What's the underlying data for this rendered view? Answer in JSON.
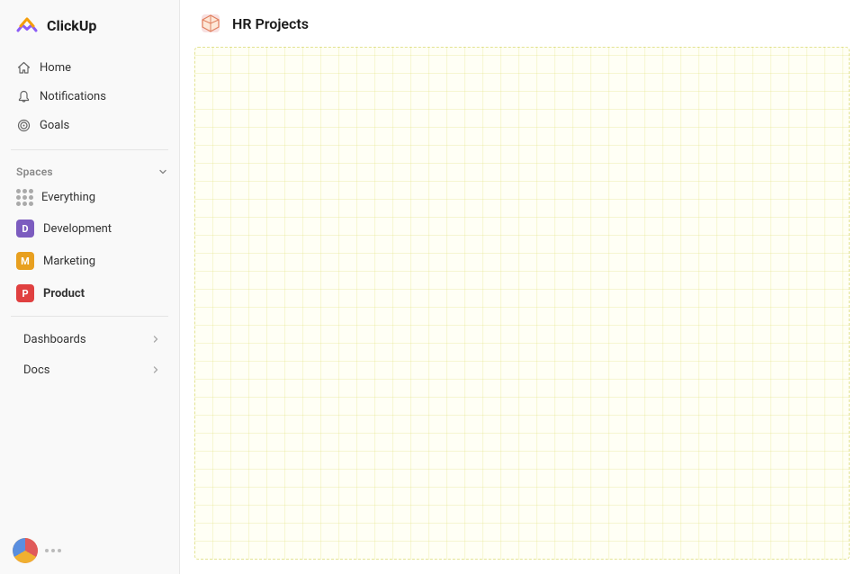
{
  "app": {
    "logo_text": "ClickUp"
  },
  "sidebar": {
    "nav_items": [
      {
        "id": "home",
        "label": "Home",
        "icon": "home-icon"
      },
      {
        "id": "notifications",
        "label": "Notifications",
        "icon": "bell-icon"
      },
      {
        "id": "goals",
        "label": "Goals",
        "icon": "target-icon"
      }
    ],
    "spaces_label": "Spaces",
    "spaces_items": [
      {
        "id": "everything",
        "label": "Everything",
        "icon": "dots-icon",
        "badge_color": null
      },
      {
        "id": "development",
        "label": "Development",
        "badge": "D",
        "badge_color": "#7c5cbf"
      },
      {
        "id": "marketing",
        "label": "Marketing",
        "badge": "M",
        "badge_color": "#e8a020"
      },
      {
        "id": "product",
        "label": "Product",
        "badge": "P",
        "badge_color": "#e04040",
        "active": true
      }
    ],
    "sections": [
      {
        "id": "dashboards",
        "label": "Dashboards"
      },
      {
        "id": "docs",
        "label": "Docs"
      }
    ],
    "bottom": {
      "dots": [
        "",
        "",
        ""
      ]
    }
  },
  "header": {
    "title": "HR Projects",
    "icon": "cube-icon"
  }
}
